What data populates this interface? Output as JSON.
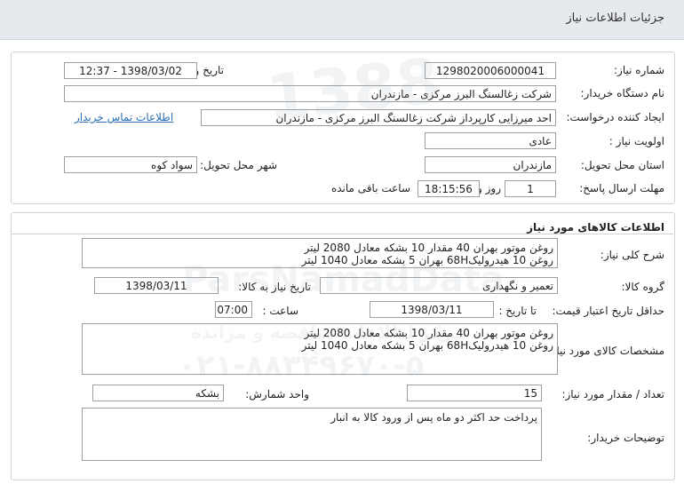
{
  "header": {
    "title": "جزئیات اطلاعات نیاز"
  },
  "need": {
    "number_label": "شماره نیاز:",
    "number_value": "1298020006000041",
    "announce_label": "تاریخ و ساعت اعلان عمومی:",
    "announce_value": "1398/03/02 - 12:37",
    "buyer_label": "نام دستگاه خریدار:",
    "buyer_value": "شرکت زغالسنگ البرز مرکزی - مازندران",
    "creator_label": "ایجاد کننده درخواست:",
    "creator_value": "احد میرزایی کارپرداز شرکت زغالسنگ البرز مرکزی - مازندران",
    "contact_link": "اطلاعات تماس خریدار",
    "priority_label": "اولویت نیاز :",
    "priority_value": "عادی",
    "province_label": "استان محل تحویل:",
    "province_value": "مازندران",
    "city_label": "شهر محل تحویل:",
    "city_value": "سواد کوه",
    "deadline_label": "مهلت ارسال پاسخ:",
    "deadline_days": "1",
    "deadline_days_unit": "روز و",
    "deadline_time": "18:15:56",
    "deadline_remaining": "ساعت باقی مانده"
  },
  "goods": {
    "section_title": "اطلاعات کالاهای مورد نیاز",
    "summary_label": "شرح کلی نیاز:",
    "summary_line1": "روغن موتور بهران 40 مقدار 10 بشکه معادل 2080 لیتر",
    "summary_line2": "روغن 10 هیدرولیک68H بهران 5 بشکه معادل 1040 لیتر",
    "group_label": "گروه کالا:",
    "group_value": "تعمیر و نگهداری",
    "need_date_label": "تاریخ نیاز به کالا:",
    "need_date_value": "1398/03/11",
    "validity_label": "حداقل تاریخ اعتبار قیمت:",
    "validity_to_date_label": "تا تاریخ :",
    "validity_date_value": "1398/03/11",
    "validity_time_label": "ساعت :",
    "validity_time_value": "07:00",
    "spec_label": "مشخصات کالای مورد نیاز:",
    "spec_line1": "روغن موتور بهران 40 مقدار 10 بشکه معادل 2080 لیتر",
    "spec_line2": "روغن 10 هیدرولیک68H بهران 5 بشکه معادل 1040 لیتر",
    "qty_label": "تعداد / مقدار مورد نیاز:",
    "qty_value": "15",
    "unit_label": "واحد شمارش:",
    "unit_value": "بشکه",
    "notes_label": "توضیحات خریدار:",
    "notes_value": "پرداخت حد اکثر دو ماه پس از ورود کالا به انبار"
  },
  "watermark": {
    "line1": "ParsNamadData",
    "line2": "مرکز اطلاعات مناقصه و مزایده",
    "line3": "۰۲۱-۸۸۳۴۹۶۷۰-۵",
    "year": "1388"
  }
}
